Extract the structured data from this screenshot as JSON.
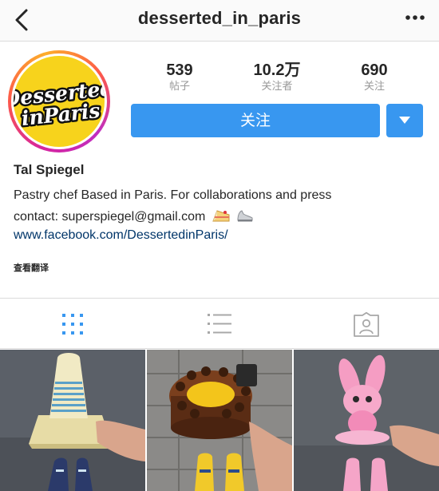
{
  "header": {
    "username": "desserted_in_paris",
    "back_icon": "back-chevron-icon",
    "more_icon": "more-options-icon"
  },
  "profile": {
    "avatar_text": "Desserted in Paris",
    "stats": [
      {
        "value": "539",
        "label": "帖子"
      },
      {
        "value": "10.2万",
        "label": "关注者"
      },
      {
        "value": "690",
        "label": "关注"
      }
    ],
    "follow_label": "关注",
    "full_name": "Tal Spiegel",
    "bio_line1": "Pastry chef Based in Paris. For collaborations and press",
    "bio_line2": "contact: superspiegel@gmail.com",
    "bio_emojis": [
      "cake-emoji",
      "sneaker-emoji"
    ],
    "website": "www.facebook.com/DessertedinParis/",
    "translate_label": "查看翻译"
  },
  "tabs": [
    {
      "name": "grid-view",
      "icon": "grid-icon",
      "active": true
    },
    {
      "name": "list-view",
      "icon": "list-icon",
      "active": false
    },
    {
      "name": "tagged",
      "icon": "tagged-person-icon",
      "active": false
    }
  ],
  "colors": {
    "accent": "#3897f0",
    "link": "#003569",
    "muted": "#999999",
    "avatar_bg": "#f7d31c"
  }
}
